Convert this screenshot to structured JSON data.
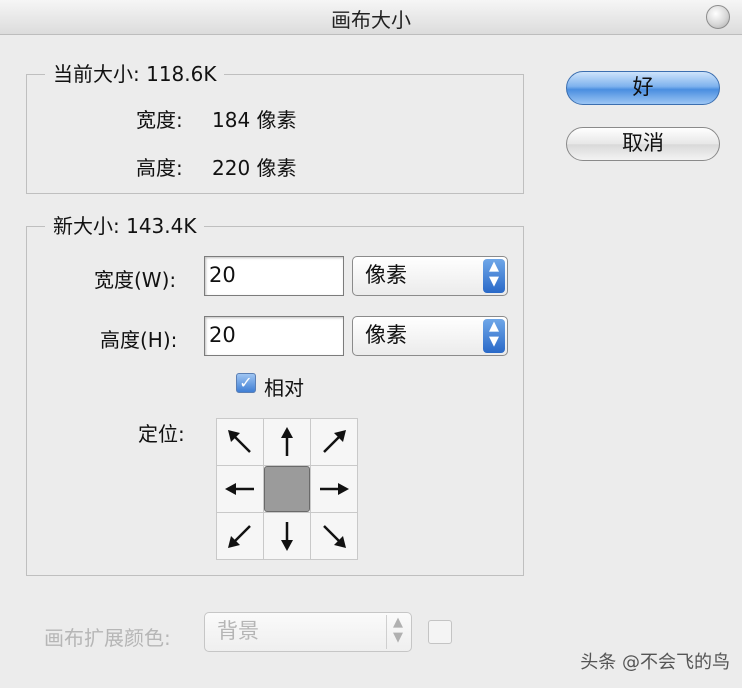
{
  "window": {
    "title": "画布大小"
  },
  "current_size": {
    "legend": "当前大小: 118.6K",
    "width_label": "宽度:",
    "width_value": "184 像素",
    "height_label": "高度:",
    "height_value": "220 像素"
  },
  "new_size": {
    "legend": "新大小: 143.4K",
    "width_label": "宽度(W):",
    "width_value": "20",
    "width_unit": "像素",
    "height_label": "高度(H):",
    "height_value": "20",
    "height_unit": "像素",
    "relative_label": "相对",
    "relative_checked": true,
    "anchor_label": "定位:",
    "anchor_selected": "center"
  },
  "extension_color": {
    "label": "画布扩展颜色:",
    "value": "背景"
  },
  "buttons": {
    "ok": "好",
    "cancel": "取消"
  },
  "watermark": "头条 @不会飞的鸟",
  "colors": {
    "accent": "#4a8ee0",
    "disabled": "#b6b6b6"
  }
}
